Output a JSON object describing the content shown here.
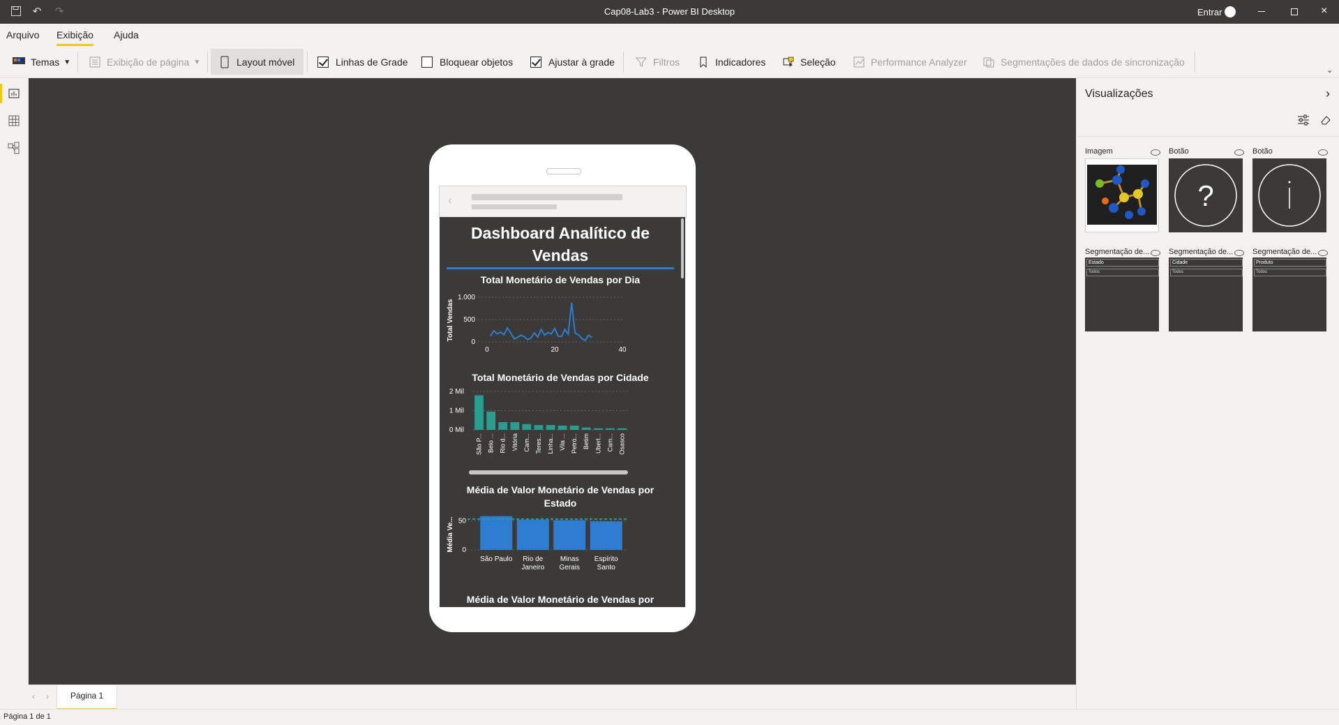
{
  "window": {
    "title": "Cap08-Lab3 - Power BI Desktop",
    "signin_label": "Entrar"
  },
  "menu": {
    "items": [
      "Arquivo",
      "Exibição",
      "Ajuda"
    ],
    "active": "Exibição"
  },
  "ribbon": {
    "themes": "Temas",
    "page_view": "Exibição de página",
    "mobile_layout": "Layout móvel",
    "gridlines": "Linhas de Grade",
    "lock_objects": "Bloquear objetos",
    "snap_to_grid": "Ajustar à grade",
    "filters": "Filtros",
    "bookmarks": "Indicadores",
    "selection": "Seleção",
    "performance": "Performance Analyzer",
    "sync_slicers": "Segmentações de dados de sincronização",
    "gridlines_checked": true,
    "lock_checked": false,
    "snap_checked": true
  },
  "phone": {
    "dashboard_title_1": "Dashboard Analítico de",
    "dashboard_title_2": "Vendas",
    "chart1_title": "Total Monetário de Vendas por Dia",
    "chart2_title": "Total Monetário de Vendas por Cidade",
    "chart3_title_1": "Média de Valor Monetário de Vendas por",
    "chart3_title_2": "Estado",
    "chart4_title": "Média de Valor Monetário de Vendas por"
  },
  "chart_data": [
    {
      "type": "line",
      "title": "Total Monetário de Vendas por Dia",
      "ylabel": "Total Vendas",
      "xlabel": "",
      "x_ticks": [
        "0",
        "20",
        "40"
      ],
      "y_ticks": [
        "0",
        "500",
        "1.000"
      ],
      "xlim": [
        0,
        40
      ],
      "ylim": [
        0,
        1000
      ],
      "color": "#2d7ed0",
      "x": [
        1,
        2,
        3,
        4,
        5,
        6,
        7,
        8,
        9,
        10,
        11,
        12,
        13,
        14,
        15,
        16,
        17,
        18,
        19,
        20,
        21,
        22,
        23,
        24,
        25,
        26,
        27,
        28,
        29,
        30,
        31
      ],
      "y": [
        130,
        250,
        180,
        220,
        160,
        310,
        200,
        70,
        100,
        150,
        120,
        50,
        90,
        200,
        110,
        280,
        150,
        210,
        180,
        300,
        130,
        120,
        280,
        170,
        880,
        200,
        160,
        80,
        30,
        150,
        100
      ]
    },
    {
      "type": "bar",
      "title": "Total Monetário de Vendas por Cidade",
      "categories": [
        "São P...",
        "Belo ...",
        "Rio d...",
        "Vitória",
        "Cam...",
        "Teres...",
        "Linha...",
        "Vila ...",
        "Petró...",
        "Betim",
        "Uberl...",
        "Cam...",
        "Osasco"
      ],
      "values": [
        1.8,
        0.95,
        0.4,
        0.4,
        0.3,
        0.25,
        0.25,
        0.22,
        0.22,
        0.12,
        0.08,
        0.08,
        0.08
      ],
      "y_ticks": [
        "0 Mil",
        "1 Mil",
        "2 Mil"
      ],
      "ylim": [
        0,
        2
      ],
      "color": "#2a9d8f"
    },
    {
      "type": "bar",
      "title": "Média de Valor Monetário de Vendas por Estado",
      "ylabel": "Média Ve...",
      "categories": [
        "São Paulo",
        "Rio de Janeiro",
        "Minas Gerais",
        "Espírito Santo"
      ],
      "values": [
        58,
        52,
        51,
        49
      ],
      "reference_line": 53,
      "y_ticks": [
        "0",
        "50"
      ],
      "ylim": [
        0,
        60
      ],
      "color": "#2d7ed0"
    }
  ],
  "visualizations": {
    "title": "Visualizações",
    "cards": [
      {
        "label": "Imagem"
      },
      {
        "label": "Botão"
      },
      {
        "label": "Botão"
      },
      {
        "label": "Segmentação de...",
        "field": "Estado",
        "value": "Todos"
      },
      {
        "label": "Segmentação de...",
        "field": "Cidade",
        "value": "Todos"
      },
      {
        "label": "Segmentação de...",
        "field": "Produto",
        "value": "Todos"
      }
    ]
  },
  "pages": {
    "tabs": [
      "Página 1"
    ],
    "status": "Página 1 de 1"
  }
}
